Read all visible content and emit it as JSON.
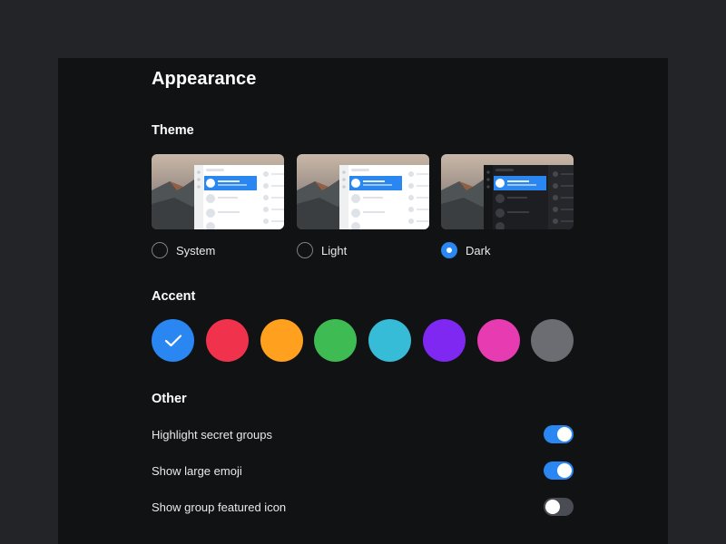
{
  "page": {
    "title": "Appearance"
  },
  "theme": {
    "heading": "Theme",
    "options": [
      {
        "label": "System",
        "selected": false
      },
      {
        "label": "Light",
        "selected": false
      },
      {
        "label": "Dark",
        "selected": true
      }
    ]
  },
  "accent": {
    "heading": "Accent",
    "selected_index": 0,
    "colors": [
      "#2a86f0",
      "#f0324c",
      "#ffa01e",
      "#3ebb52",
      "#36bcd7",
      "#7f28f2",
      "#e63bb1",
      "#6b6d72"
    ]
  },
  "other": {
    "heading": "Other",
    "settings": [
      {
        "label": "Highlight secret groups",
        "enabled": true
      },
      {
        "label": "Show large emoji",
        "enabled": true
      },
      {
        "label": "Show group featured icon",
        "enabled": false
      }
    ]
  }
}
